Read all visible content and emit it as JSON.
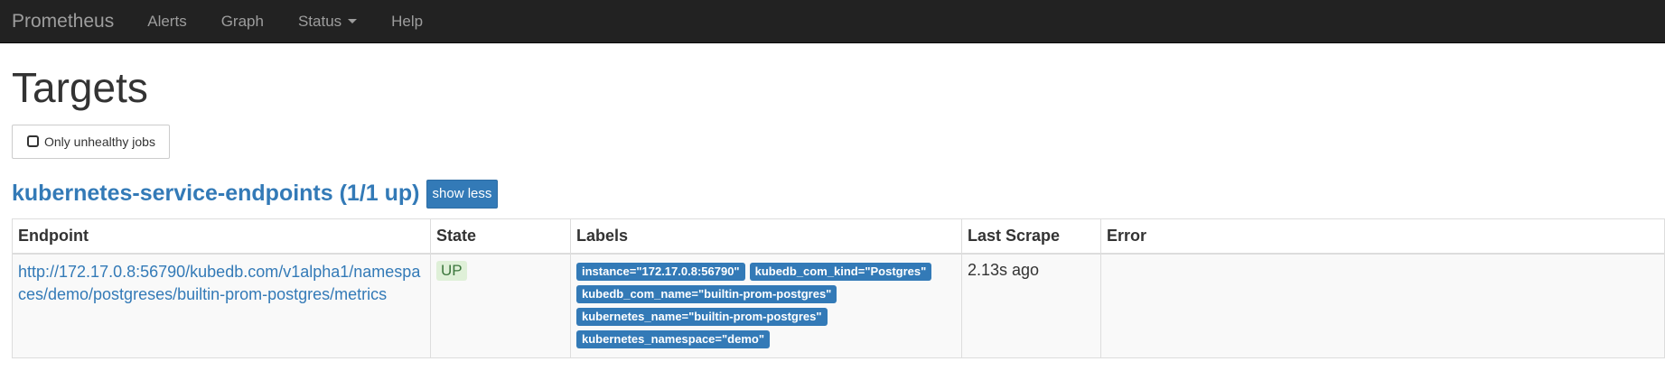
{
  "navbar": {
    "brand": "Prometheus",
    "items": [
      {
        "label": "Alerts"
      },
      {
        "label": "Graph"
      },
      {
        "label": "Status"
      },
      {
        "label": "Help"
      }
    ]
  },
  "page": {
    "title": "Targets",
    "filter_button": "Only unhealthy jobs"
  },
  "job": {
    "title": "kubernetes-service-endpoints (1/1 up)",
    "toggle_button": "show less"
  },
  "table": {
    "headers": [
      "Endpoint",
      "State",
      "Labels",
      "Last Scrape",
      "Error"
    ],
    "rows": [
      {
        "endpoint": "http://172.17.0.8:56790/kubedb.com/v1alpha1/namespaces/demo/postgreses/builtin-prom-postgres/metrics",
        "state": "UP",
        "labels": [
          "instance=\"172.17.0.8:56790\"",
          "kubedb_com_kind=\"Postgres\"",
          "kubedb_com_name=\"builtin-prom-postgres\"",
          "kubernetes_name=\"builtin-prom-postgres\"",
          "kubernetes_namespace=\"demo\""
        ],
        "last_scrape": "2.13s ago",
        "error": ""
      }
    ]
  },
  "colors": {
    "navbar_bg": "#222222",
    "link": "#337ab7",
    "up_badge_bg": "#dff0d8",
    "up_badge_text": "#3c763d"
  }
}
